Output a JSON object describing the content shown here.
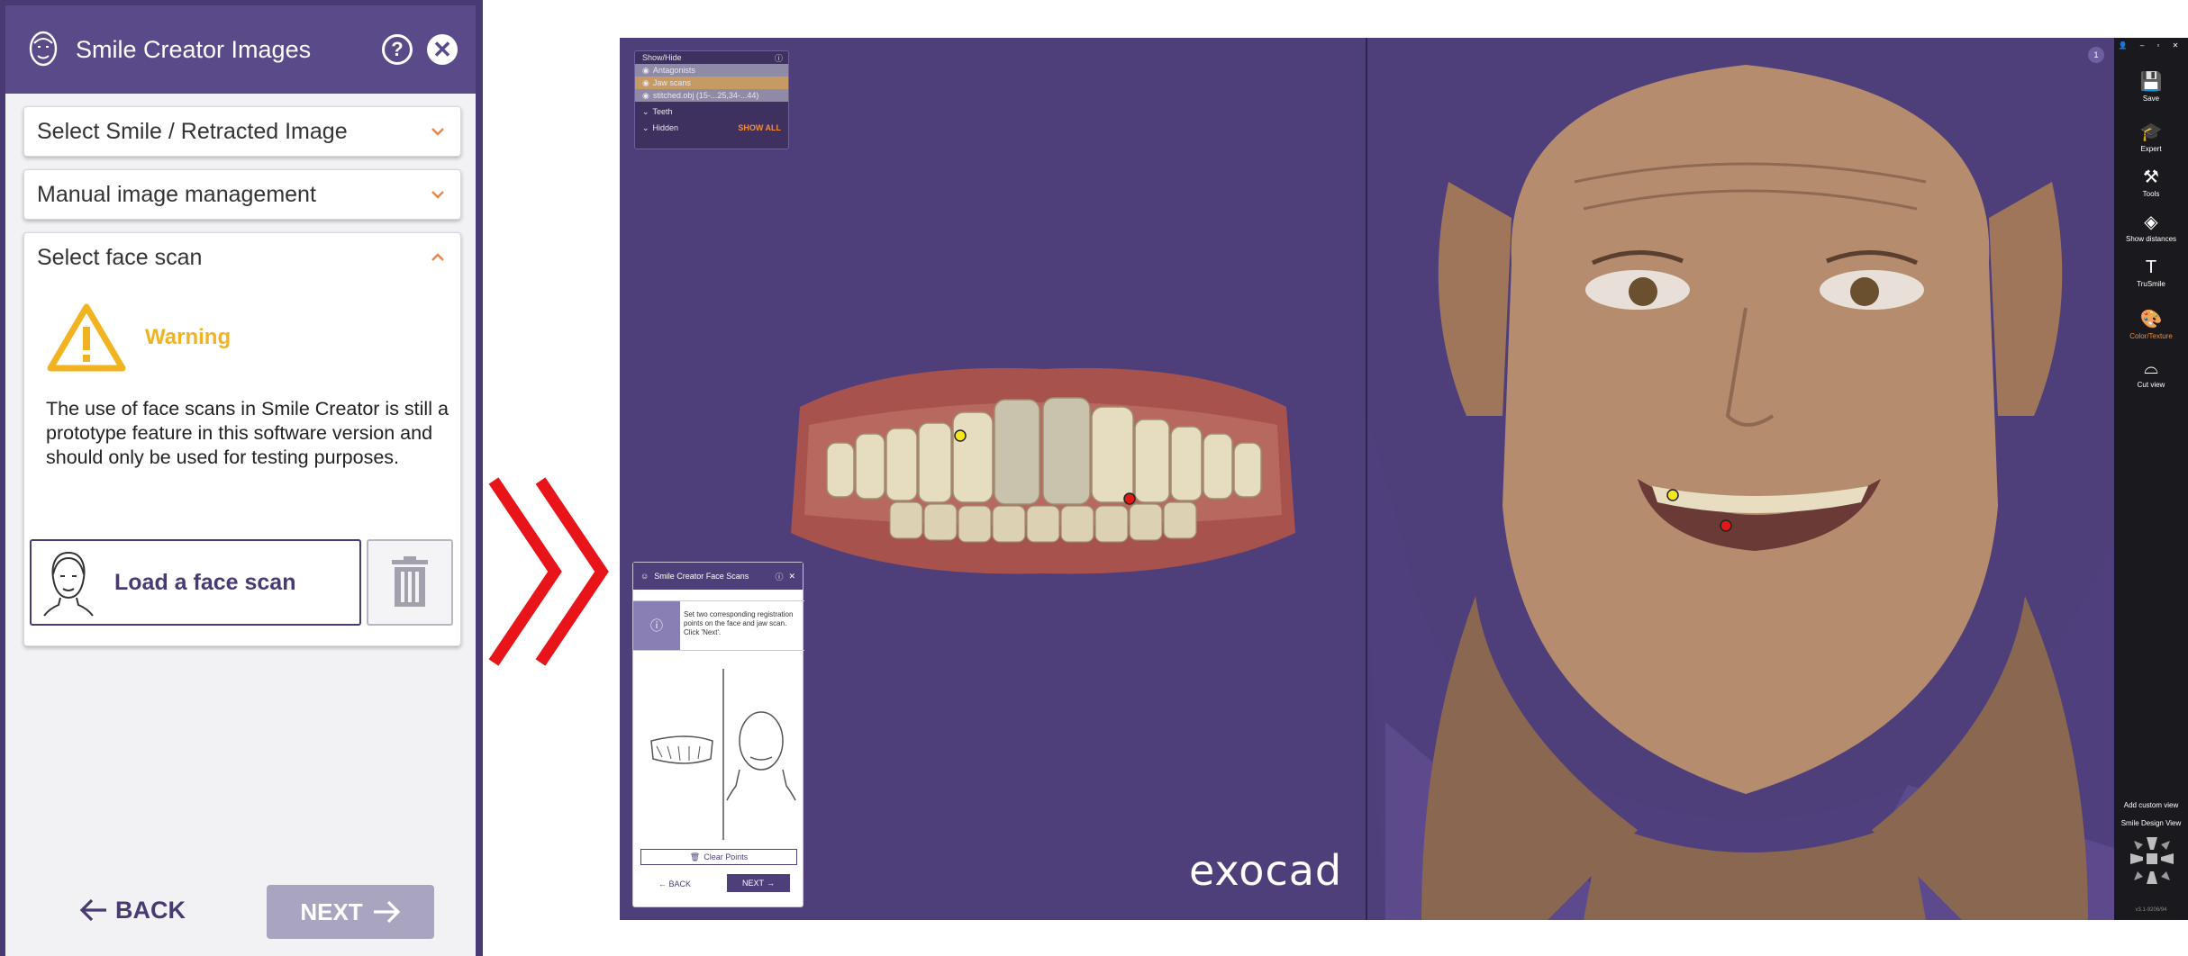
{
  "left_panel": {
    "title": "Smile Creator Images",
    "help_glyph": "?",
    "close_glyph": "✕",
    "accordions": [
      {
        "label": "Select Smile / Retracted Image",
        "expanded": false
      },
      {
        "label": "Manual image management",
        "expanded": false
      },
      {
        "label": "Select face scan",
        "expanded": true
      }
    ],
    "warning_title": "Warning",
    "warning_text": "The use of face scans in Smile Creator is still a prototype feature in this software version and should only be used for testing purposes.",
    "load_button": "Load a face scan",
    "back_label": "BACK",
    "next_label": "NEXT",
    "colors": {
      "header": "#5a4a8a",
      "accent": "#f2b322",
      "chevron": "#e8874a",
      "next_disabled": "#a9a4bf"
    }
  },
  "arrow_color": "#e8141a",
  "app": {
    "showhide": {
      "title": "Show/Hide",
      "items": [
        "Antagonists",
        "Jaw scans",
        "stitched.obj (15-...25,34-...44)"
      ],
      "teeth_label": "Teeth",
      "hidden_label": "Hidden",
      "show_all": "SHOW ALL"
    },
    "face_scans_panel": {
      "title": "Smile Creator Face Scans",
      "info_text": "Set two corresponding registration points on the face and jaw scan. Click 'Next'.",
      "clear_points": "Clear Points",
      "back": "BACK",
      "next": "NEXT"
    },
    "brand": "exocad",
    "notification_count": "1",
    "toolbar": {
      "items": [
        {
          "label": "Save",
          "icon": "save-icon"
        },
        {
          "label": "Expert",
          "icon": "graduation-cap-icon"
        },
        {
          "label": "Tools",
          "icon": "tools-icon"
        },
        {
          "label": "Show distances",
          "icon": "distances-icon"
        },
        {
          "label": "TruSmile",
          "icon": "trusmile-icon"
        },
        {
          "label": "Color/Texture",
          "icon": "palette-icon"
        },
        {
          "label": "Cut view",
          "icon": "cut-view-icon"
        }
      ],
      "add_custom_view": "Add custom view",
      "smile_design_view": "Smile Design View",
      "version": "v3.1-9206/94"
    }
  }
}
